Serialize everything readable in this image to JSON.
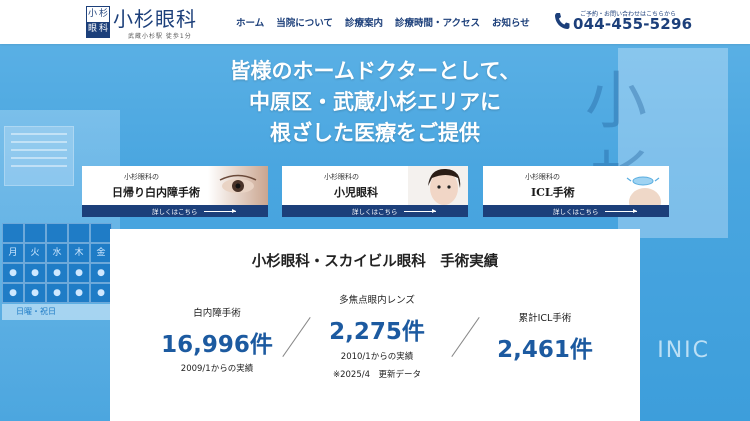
{
  "header": {
    "logo_mark": [
      "小",
      "杉",
      "眼",
      "科"
    ],
    "logo_text": "小杉眼科",
    "logo_sub": "武蔵小杉駅 徒歩1分",
    "nav": [
      "ホーム",
      "当院について",
      "診療案内",
      "診療時間・アクセス",
      "お知らせ"
    ],
    "tel_note": "ご予約・お問い合わせはこちらから",
    "tel_number": "044-455-5296"
  },
  "hero": {
    "headline_lines": [
      "皆様のホームドクターとして、",
      "中原区・武蔵小杉エリアに",
      "根ざした医療をご提供"
    ]
  },
  "banners": [
    {
      "pre": "小杉眼科の",
      "title": "日帰り白内障手術",
      "link": "詳しくはこちら"
    },
    {
      "pre": "小杉眼科の",
      "title": "小児眼科",
      "link": "詳しくはこちら"
    },
    {
      "pre": "小杉眼科の",
      "title": "ICL手術",
      "link": "詳しくはこちら"
    }
  ],
  "stats": {
    "title": "小杉眼科・スカイビル眼科　手術実績",
    "items": [
      {
        "label": "白内障手術",
        "value": "16,996件",
        "note": "2009/1からの実績"
      },
      {
        "label": "多焦点眼内レンズ",
        "value": "2,275件",
        "note": "2010/1からの実績",
        "note2": "※2025/4　更新データ"
      },
      {
        "label": "累計ICL手術",
        "value": "2,461件"
      }
    ]
  },
  "background": {
    "weekdays": [
      "月",
      "火",
      "水",
      "木",
      "金"
    ],
    "holiday_text": "日曜・祝日",
    "sign_glyphs": [
      "小",
      "杉"
    ],
    "sign_text": "INIC"
  },
  "colors": {
    "brand": "#1c3f7a",
    "accent": "#1c5aa0",
    "hero_bg": "#4aa6e0"
  }
}
